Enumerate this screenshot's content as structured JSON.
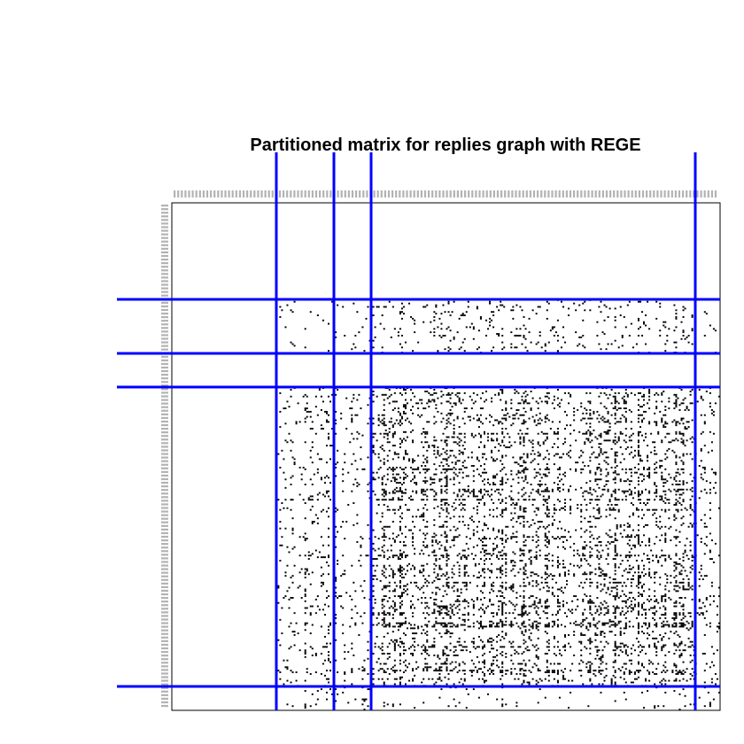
{
  "chart_data": {
    "type": "heatmap",
    "title": "Partitioned matrix for replies graph with REGE",
    "xlabel": "",
    "ylabel": "",
    "n": 300,
    "cluster_boundaries": [
      62,
      95,
      116,
      306
    ],
    "tick_labels_note": "",
    "legend": "none",
    "grid": false,
    "colors": {
      "cell": "#000000",
      "partition_line": "#0000ff",
      "frame": "#000000",
      "tick_label": "#b3b3b3"
    },
    "block_density": [
      [
        0.0,
        0.0,
        0.0,
        0.0
      ],
      [
        0.0,
        0.04,
        0.03,
        0.02,
        0.05
      ],
      [
        0.0,
        0.0,
        0.0,
        0.0
      ],
      [
        0.0,
        0.08,
        0.04,
        0.12
      ],
      [
        0.0,
        0.03,
        0.03,
        0.01
      ]
    ],
    "row_cluster_boundaries": [
      57,
      89,
      108,
      282,
      300
    ]
  }
}
